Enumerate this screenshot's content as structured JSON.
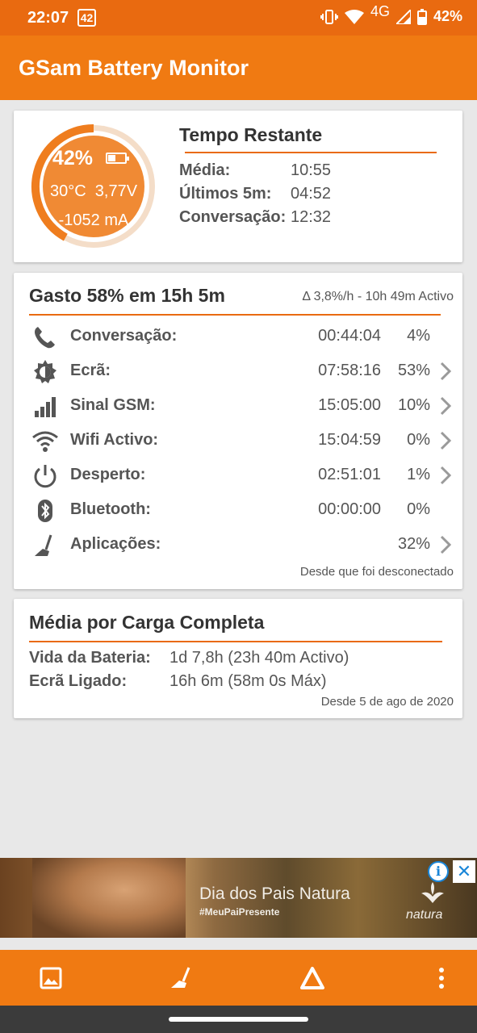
{
  "status_bar": {
    "time": "22:07",
    "notification_badge": "42",
    "network": "4G",
    "battery_percent": "42%",
    "icons": [
      "vibrate-icon",
      "wifi-icon",
      "signal-icon",
      "battery-icon"
    ]
  },
  "app_bar": {
    "title": "GSam Battery Monitor"
  },
  "summary_card": {
    "gauge": {
      "percent": "42%",
      "level": 0.42,
      "temperature": "30°C",
      "voltage": "3,77V",
      "current": "-1052 mA"
    },
    "time_remaining": {
      "title": "Tempo Restante",
      "rows": [
        {
          "label": "Média:",
          "value": "10:55"
        },
        {
          "label": "Últimos 5m:",
          "value": "04:52"
        },
        {
          "label": "Conversação:",
          "value": "12:32"
        }
      ]
    }
  },
  "usage_card": {
    "title": "Gasto 58% em 15h 5m",
    "rate": "Δ 3,8%/h - 10h 49m Activo",
    "rows": [
      {
        "icon": "phone-icon",
        "label": "Conversação:",
        "time": "00:44:04",
        "percent": "4%"
      },
      {
        "icon": "brightness-icon",
        "label": "Ecrã:",
        "time": "07:58:16",
        "percent": "53%"
      },
      {
        "icon": "signal-bars-icon",
        "label": "Sinal GSM:",
        "time": "15:05:00",
        "percent": "10%"
      },
      {
        "icon": "wifi-icon",
        "label": "Wifi Activo:",
        "time": "15:04:59",
        "percent": "0%"
      },
      {
        "icon": "power-icon",
        "label": "Desperto:",
        "time": "02:51:01",
        "percent": "1%"
      },
      {
        "icon": "bluetooth-icon",
        "label": "Bluetooth:",
        "time": "00:00:00",
        "percent": "0%"
      },
      {
        "icon": "broom-icon",
        "label": "Aplicações:",
        "time": "",
        "percent": "32%"
      }
    ],
    "footer": "Desde que foi desconectado"
  },
  "full_charge_card": {
    "title": "Média por Carga Completa",
    "rows": [
      {
        "label": "Vida da Bateria:",
        "value": "1d 7,8h (23h 40m Activo)"
      },
      {
        "label": "Ecrã Ligado:",
        "value": "16h 6m (58m 0s Máx)"
      }
    ],
    "footer": "Desde 5 de ago de 2020"
  },
  "ad_banner": {
    "headline": "Dia dos Pais Natura",
    "hashtag": "#MeuPaiPresente",
    "brand": "natura",
    "info_label": "i",
    "close_label": "✕"
  },
  "bottom_bar": {
    "buttons": [
      "image-icon",
      "broom-icon",
      "warning-triangle-icon",
      "more-vertical-icon"
    ]
  },
  "colors": {
    "accent": "#f07a12",
    "status_bar": "#e96a10",
    "gauge_fill": "#f08a34"
  }
}
